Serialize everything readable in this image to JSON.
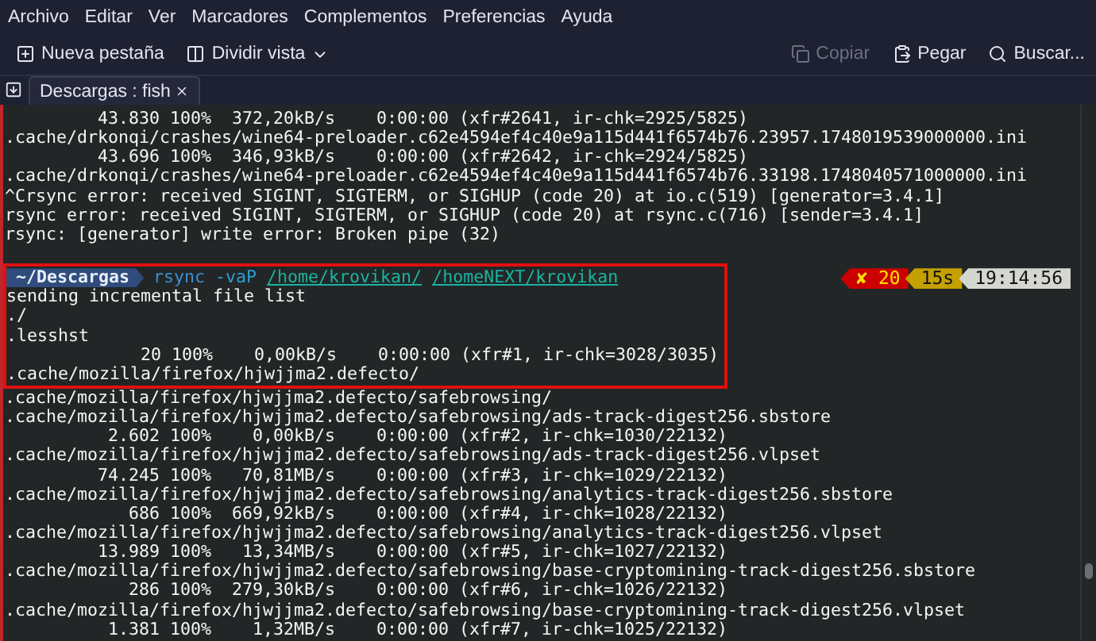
{
  "menu": [
    {
      "label": "Archivo"
    },
    {
      "label": "Editar"
    },
    {
      "label": "Ver"
    },
    {
      "label": "Marcadores"
    },
    {
      "label": "Complementos"
    },
    {
      "label": "Preferencias"
    },
    {
      "label": "Ayuda"
    }
  ],
  "toolbar": {
    "left": [
      {
        "label": "Nueva pestaña",
        "disabled": false
      },
      {
        "label": "Dividir vista",
        "disabled": false
      }
    ],
    "right": [
      {
        "label": "Copiar",
        "disabled": true
      },
      {
        "label": "Pegar",
        "disabled": false
      },
      {
        "label": "Buscar...",
        "disabled": false
      }
    ]
  },
  "tabs": [
    {
      "label": "Descargas : fish",
      "selected": true
    }
  ],
  "terminal": {
    "scrollback": [
      "         43.830 100%  372,20kB/s    0:00:00 (xfr#2641, ir-chk=2925/5825)",
      ".cache/drkonqi/crashes/wine64-preloader.c62e4594ef4c40e9a115d441f6574b76.23957.1748019539000000.ini",
      "         43.696 100%  346,93kB/s    0:00:00 (xfr#2642, ir-chk=2924/5825)",
      ".cache/drkonqi/crashes/wine64-preloader.c62e4594ef4c40e9a115d441f6574b76.33198.1748040571000000.ini",
      "^Crsync error: received SIGINT, SIGTERM, or SIGHUP (code 20) at io.c(519) [generator=3.4.1]",
      "rsync error: received SIGINT, SIGTERM, or SIGHUP (code 20) at rsync.c(716) [sender=3.4.1]",
      "rsync: [generator] write error: Broken pipe (32)"
    ],
    "highlighted": {
      "prompt": {
        "dir": "~/Descargas",
        "command": "rsync",
        "args": [
          {
            "text": "-vaP",
            "kind": "flag"
          },
          {
            "text": "/home/krovikan/",
            "kind": "path"
          },
          {
            "text": "/homeNEXT/krovikan",
            "kind": "path"
          }
        ]
      },
      "output": [
        "sending incremental file list",
        "./",
        ".lesshst",
        "             20 100%    0,00kB/s    0:00:00 (xfr#1, ir-chk=3028/3035)",
        ".cache/mozilla/firefox/hjwjjma2.defecto/"
      ]
    },
    "status": [
      {
        "text": "✘ 20",
        "kind": "error"
      },
      {
        "text": "15s",
        "kind": "duration"
      },
      {
        "text": "19:14:56",
        "kind": "time"
      }
    ],
    "continued": [
      ".cache/mozilla/firefox/hjwjjma2.defecto/safebrowsing/",
      ".cache/mozilla/firefox/hjwjjma2.defecto/safebrowsing/ads-track-digest256.sbstore",
      "          2.602 100%    0,00kB/s    0:00:00 (xfr#2, ir-chk=1030/22132)",
      ".cache/mozilla/firefox/hjwjjma2.defecto/safebrowsing/ads-track-digest256.vlpset",
      "         74.245 100%   70,81MB/s    0:00:00 (xfr#3, ir-chk=1029/22132)",
      ".cache/mozilla/firefox/hjwjjma2.defecto/safebrowsing/analytics-track-digest256.sbstore",
      "            686 100%  669,92kB/s    0:00:00 (xfr#4, ir-chk=1028/22132)",
      ".cache/mozilla/firefox/hjwjjma2.defecto/safebrowsing/analytics-track-digest256.vlpset",
      "         13.989 100%   13,34MB/s    0:00:00 (xfr#5, ir-chk=1027/22132)",
      ".cache/mozilla/firefox/hjwjjma2.defecto/safebrowsing/base-cryptomining-track-digest256.sbstore",
      "            286 100%  279,30kB/s    0:00:00 (xfr#6, ir-chk=1026/22132)",
      ".cache/mozilla/firefox/hjwjjma2.defecto/safebrowsing/base-cryptomining-track-digest256.vlpset",
      "          1.381 100%    1,32MB/s    0:00:00 (xfr#7, ir-chk=1025/22132)"
    ]
  }
}
